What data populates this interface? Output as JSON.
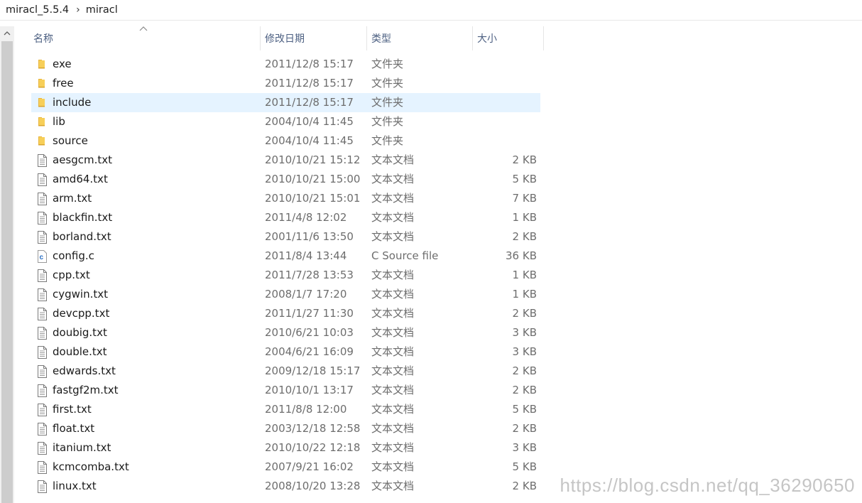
{
  "breadcrumb": {
    "items": [
      "miracl_5.5.4",
      "miracl"
    ],
    "separator": "›"
  },
  "columns": {
    "name": "名称",
    "date": "修改日期",
    "type": "类型",
    "size": "大小"
  },
  "files": [
    {
      "name": "exe",
      "date": "2011/12/8 15:17",
      "type": "文件夹",
      "size": "",
      "icon": "folder-icon"
    },
    {
      "name": "free",
      "date": "2011/12/8 15:17",
      "type": "文件夹",
      "size": "",
      "icon": "folder-icon"
    },
    {
      "name": "include",
      "date": "2011/12/8 15:17",
      "type": "文件夹",
      "size": "",
      "icon": "folder-icon",
      "selected": true
    },
    {
      "name": "lib",
      "date": "2004/10/4 11:45",
      "type": "文件夹",
      "size": "",
      "icon": "folder-icon"
    },
    {
      "name": "source",
      "date": "2004/10/4 11:45",
      "type": "文件夹",
      "size": "",
      "icon": "folder-icon"
    },
    {
      "name": "aesgcm.txt",
      "date": "2010/10/21 15:12",
      "type": "文本文档",
      "size": "2 KB",
      "icon": "text-file-icon"
    },
    {
      "name": "amd64.txt",
      "date": "2010/10/21 15:00",
      "type": "文本文档",
      "size": "5 KB",
      "icon": "text-file-icon"
    },
    {
      "name": "arm.txt",
      "date": "2010/10/21 15:01",
      "type": "文本文档",
      "size": "7 KB",
      "icon": "text-file-icon"
    },
    {
      "name": "blackfin.txt",
      "date": "2011/4/8 12:02",
      "type": "文本文档",
      "size": "1 KB",
      "icon": "text-file-icon"
    },
    {
      "name": "borland.txt",
      "date": "2001/11/6 13:50",
      "type": "文本文档",
      "size": "2 KB",
      "icon": "text-file-icon"
    },
    {
      "name": "config.c",
      "date": "2011/8/4 13:44",
      "type": "C Source file",
      "size": "36 KB",
      "icon": "c-source-file-icon"
    },
    {
      "name": "cpp.txt",
      "date": "2011/7/28 13:53",
      "type": "文本文档",
      "size": "1 KB",
      "icon": "text-file-icon"
    },
    {
      "name": "cygwin.txt",
      "date": "2008/1/7 17:20",
      "type": "文本文档",
      "size": "1 KB",
      "icon": "text-file-icon"
    },
    {
      "name": "devcpp.txt",
      "date": "2011/1/27 11:30",
      "type": "文本文档",
      "size": "2 KB",
      "icon": "text-file-icon"
    },
    {
      "name": "doubig.txt",
      "date": "2010/6/21 10:03",
      "type": "文本文档",
      "size": "3 KB",
      "icon": "text-file-icon"
    },
    {
      "name": "double.txt",
      "date": "2004/6/21 16:09",
      "type": "文本文档",
      "size": "3 KB",
      "icon": "text-file-icon"
    },
    {
      "name": "edwards.txt",
      "date": "2009/12/18 15:17",
      "type": "文本文档",
      "size": "2 KB",
      "icon": "text-file-icon"
    },
    {
      "name": "fastgf2m.txt",
      "date": "2010/10/1 13:17",
      "type": "文本文档",
      "size": "2 KB",
      "icon": "text-file-icon"
    },
    {
      "name": "first.txt",
      "date": "2011/8/8 12:00",
      "type": "文本文档",
      "size": "5 KB",
      "icon": "text-file-icon"
    },
    {
      "name": "float.txt",
      "date": "2003/12/18 12:58",
      "type": "文本文档",
      "size": "2 KB",
      "icon": "text-file-icon"
    },
    {
      "name": "itanium.txt",
      "date": "2010/10/22 12:18",
      "type": "文本文档",
      "size": "3 KB",
      "icon": "text-file-icon"
    },
    {
      "name": "kcmcomba.txt",
      "date": "2007/9/21 16:02",
      "type": "文本文档",
      "size": "5 KB",
      "icon": "text-file-icon"
    },
    {
      "name": "linux.txt",
      "date": "2008/10/20 13:28",
      "type": "文本文档",
      "size": "2 KB",
      "icon": "text-file-icon"
    }
  ],
  "watermark": "https://blog.csdn.net/qq_36290650",
  "colors": {
    "selected_row": "#e5f3ff",
    "header_text": "#4d6082",
    "folder": "#f7cf59",
    "c_source": "#2a6fc4"
  }
}
